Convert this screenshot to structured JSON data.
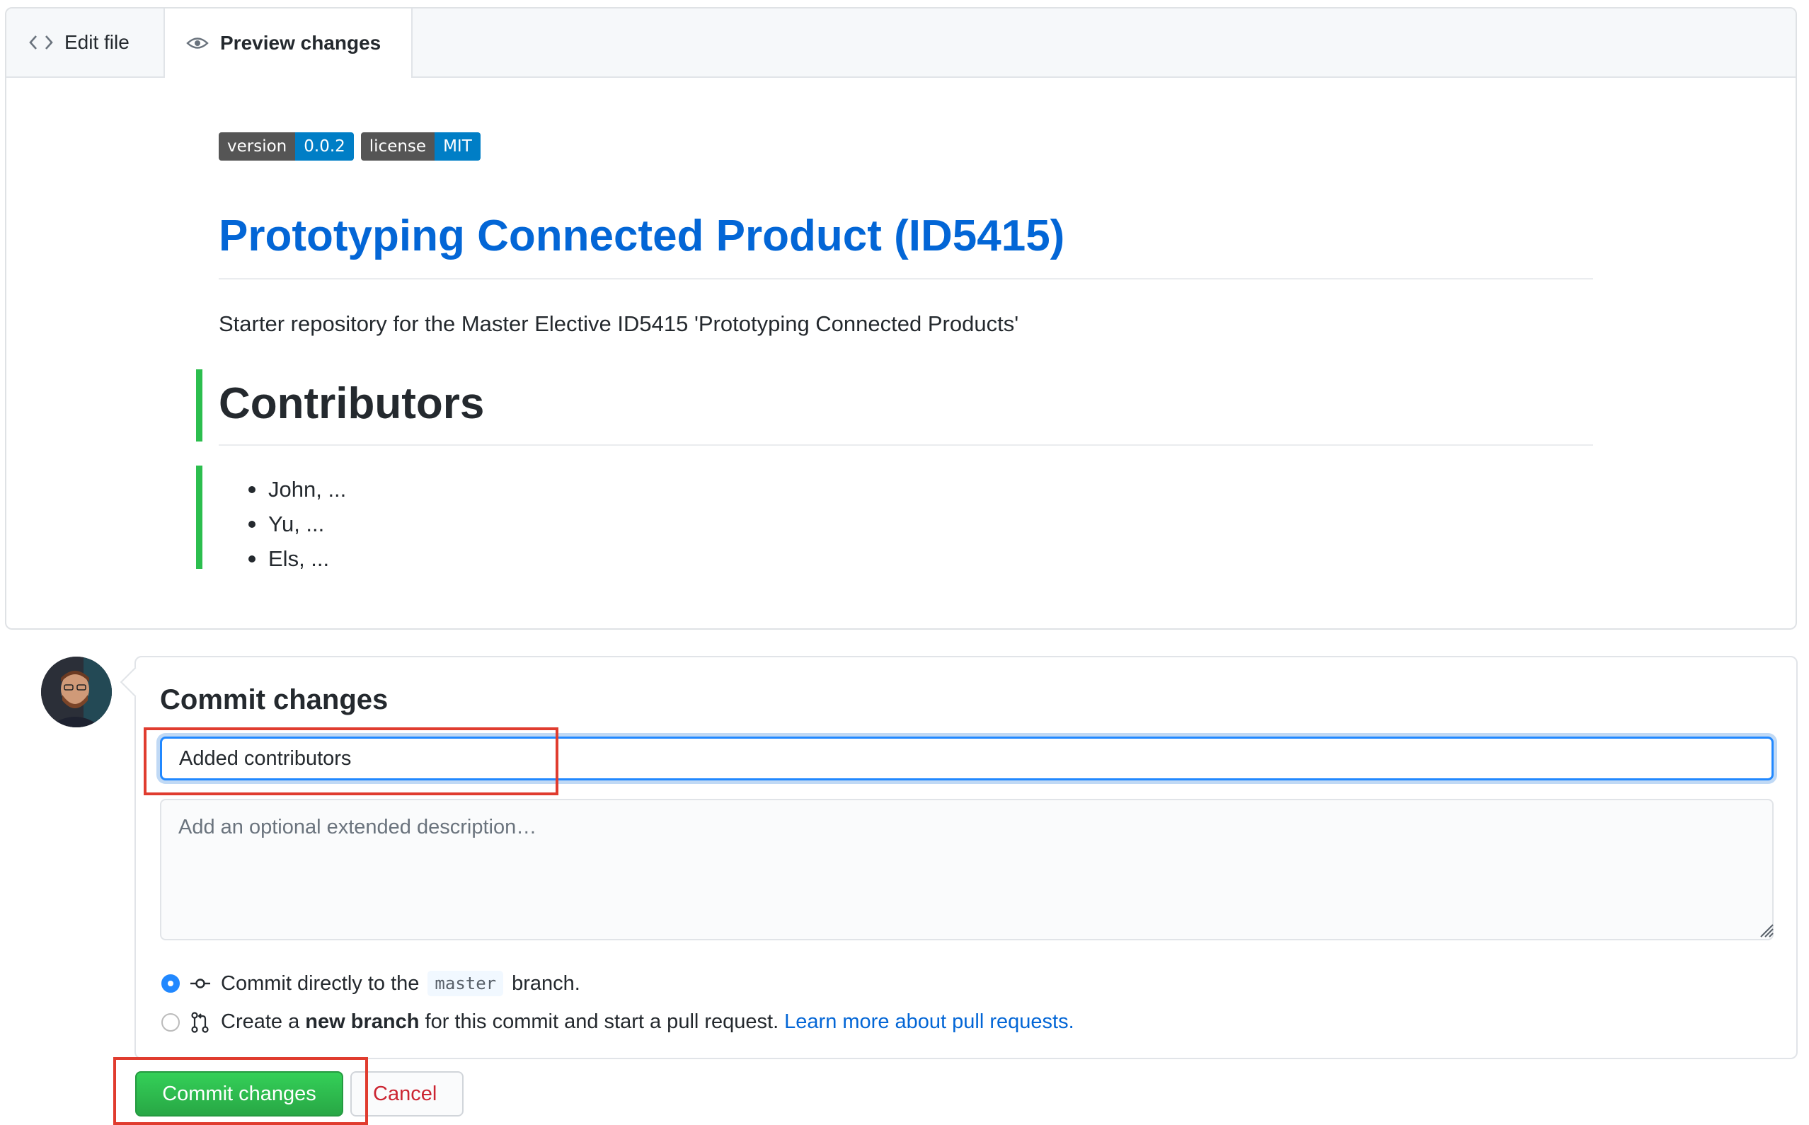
{
  "tabs": {
    "edit_label": "Edit file",
    "preview_label": "Preview changes"
  },
  "preview": {
    "badges": [
      {
        "key": "version",
        "value": "0.0.2"
      },
      {
        "key": "license",
        "value": "MIT"
      }
    ],
    "title": "Prototyping Connected Product (ID5415)",
    "description": "Starter repository for the Master Elective ID5415 'Prototyping Connected Products'",
    "contributors_heading": "Contributors",
    "contributors": [
      "John, ...",
      "Yu, ...",
      "Els, ..."
    ]
  },
  "commit": {
    "title": "Commit changes",
    "summary_value": "Added contributors",
    "description_placeholder": "Add an optional extended description…",
    "option_direct": {
      "text_before": "Commit directly to the",
      "branch": "master",
      "text_after": "branch."
    },
    "option_new_branch": {
      "text_before": "Create a",
      "bold": "new branch",
      "text_after": "for this commit and start a pull request.",
      "link": "Learn more about pull requests."
    },
    "selected_option": "direct",
    "commit_button_label": "Commit changes",
    "cancel_button_label": "Cancel"
  },
  "colors": {
    "link_blue": "#0366d6",
    "commit_green": "#28a745",
    "cancel_red": "#cb2431",
    "highlight_red": "#e03c2f",
    "changed_bar_green": "#2cbe4e"
  }
}
